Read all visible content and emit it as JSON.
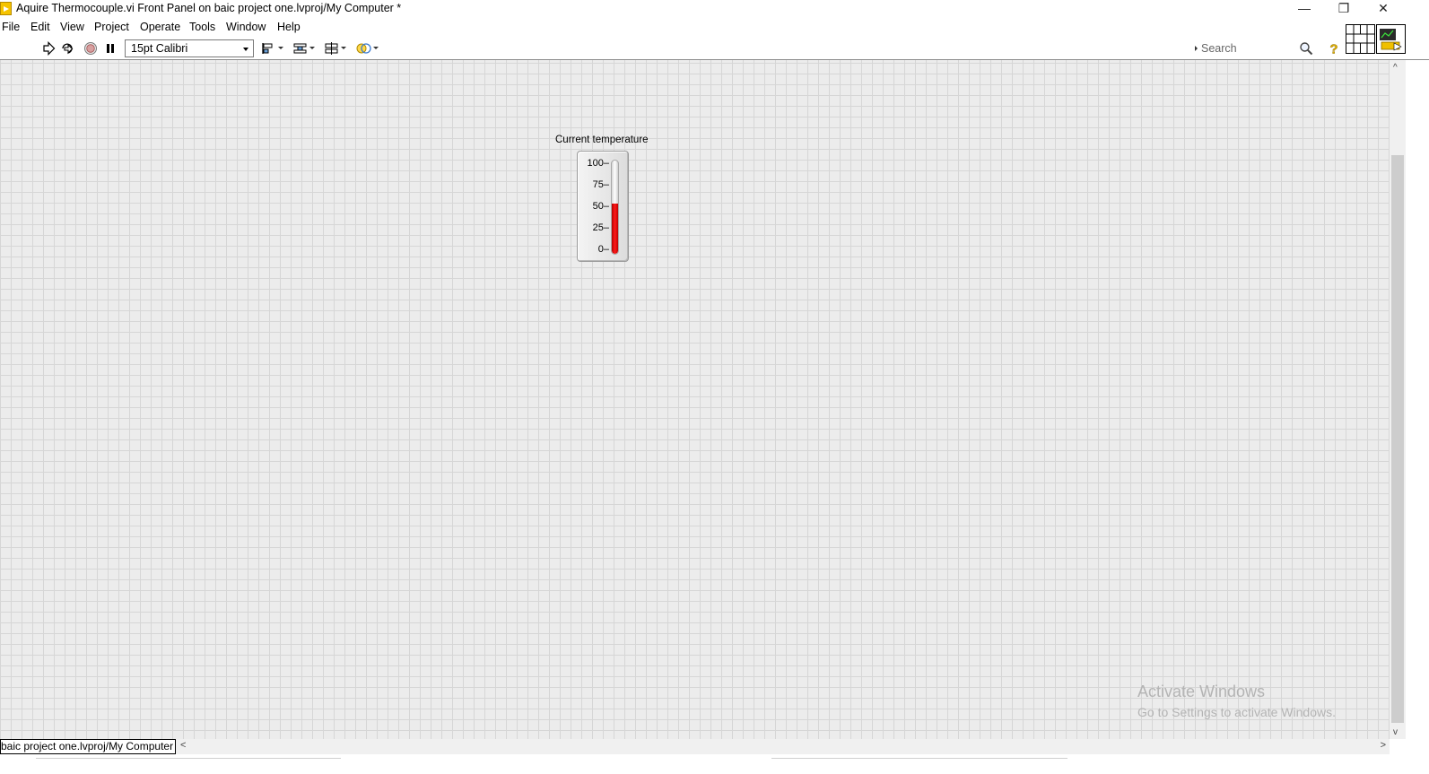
{
  "window": {
    "title": "Aquire Thermocouple.vi Front Panel on baic project one.lvproj/My Computer *",
    "minimize_glyph": "—",
    "maximize_glyph": "❐",
    "close_glyph": "✕"
  },
  "menu": [
    "File",
    "Edit",
    "View",
    "Project",
    "Operate",
    "Tools",
    "Window",
    "Help"
  ],
  "toolbar": {
    "font_setting": "15pt Calibri",
    "search_placeholder": "Search",
    "icons": [
      "run-arrow-icon",
      "run-continuously-icon",
      "abort-execution-icon",
      "pause-icon",
      "align-objects-icon",
      "distribute-objects-icon",
      "resize-objects-icon",
      "reorder-icon",
      "search-icon",
      "context-help-icon",
      "connector-pane-icon",
      "vi-icon"
    ]
  },
  "panel": {
    "indicator": {
      "label": "Current temperature",
      "scale": [
        "100",
        "75",
        "50",
        "25",
        "0"
      ],
      "scale_min": 0,
      "scale_max": 100,
      "value": 52,
      "fill_color": "#e00000"
    }
  },
  "watermark": {
    "line1": "Activate Windows",
    "line2": "Go to Settings to activate Windows."
  },
  "status": {
    "context": "baic project one.lvproj/My Computer",
    "scroll_left_glyph": "<",
    "scroll_right_glyph": ">",
    "scroll_up_glyph": "^",
    "scroll_down_glyph": "v"
  }
}
